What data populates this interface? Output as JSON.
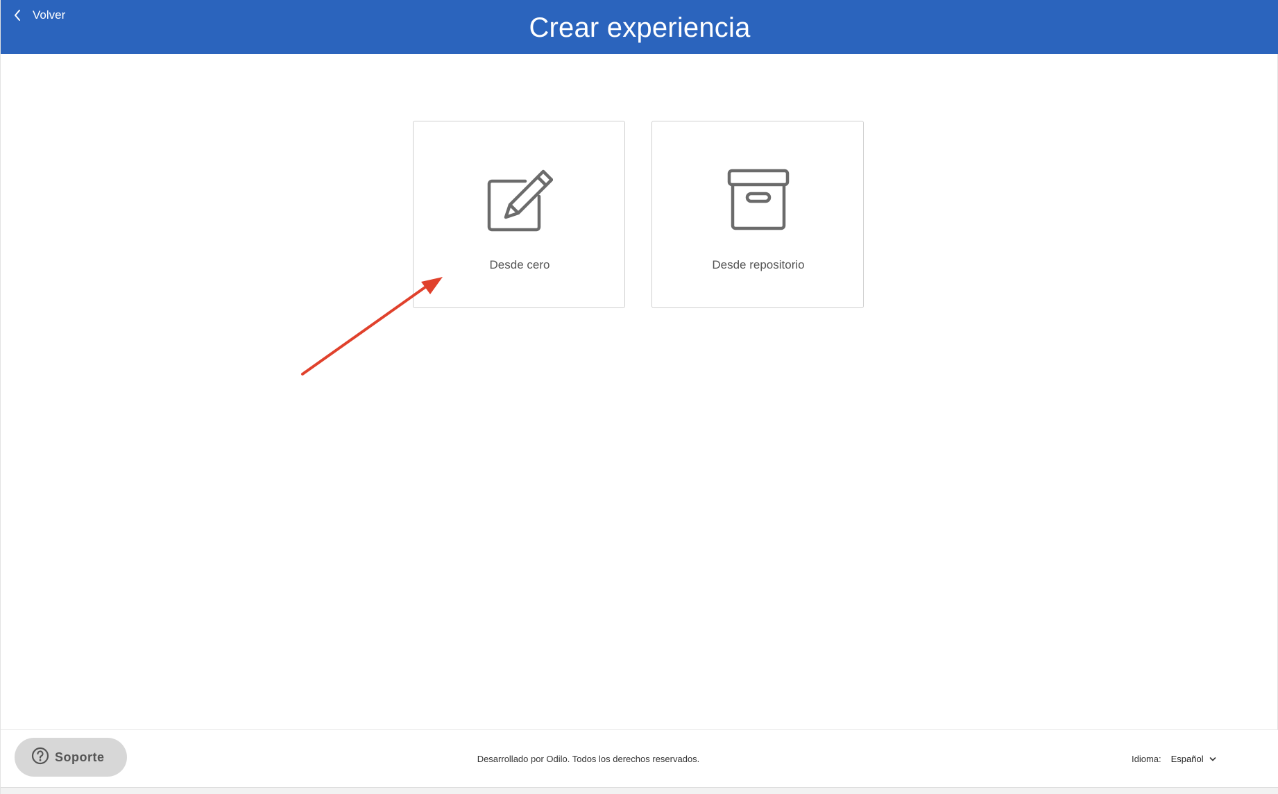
{
  "header": {
    "back_label": "Volver",
    "title": "Crear experiencia",
    "background_color": "#2b64bd"
  },
  "cards": [
    {
      "label": "Desde cero",
      "icon": "edit-icon"
    },
    {
      "label": "Desde repositorio",
      "icon": "archive-box-icon"
    }
  ],
  "annotation": {
    "type": "arrow",
    "color": "#e0412c",
    "points_to": "Desde cero"
  },
  "footer": {
    "support_label": "Soporte",
    "support_icon": "question-circle-icon",
    "copyright": "Desarrollado por Odilo. Todos los derechos reservados.",
    "language_label": "Idioma:",
    "language_value": "Español"
  }
}
